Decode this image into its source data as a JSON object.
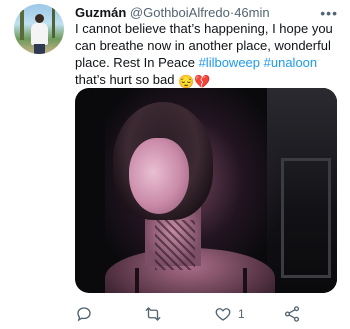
{
  "tweet": {
    "author_name": "Guzmán",
    "author_handle": "@GothboiAlfredo",
    "separator": "·",
    "time": "46min",
    "text_part1": "I cannot believe that’s happening, I hope you can breathe now in another place, wonderful place. Rest In Peace ",
    "hashtag1": "#lilboweep",
    "hashtag2": "#unaloon",
    "text_part2": "that’s hurt so bad",
    "emoji1": "😔",
    "emoji2": "💔"
  },
  "actions": {
    "reply_count": "",
    "retweet_count": "",
    "like_count": "1",
    "share_count": ""
  },
  "icons": {
    "more": "more-options-icon",
    "reply": "reply-icon",
    "retweet": "retweet-icon",
    "like": "heart-icon",
    "share": "share-icon"
  },
  "colors": {
    "link": "#1d9bf0",
    "secondary": "#536471",
    "text": "#0f1419"
  }
}
